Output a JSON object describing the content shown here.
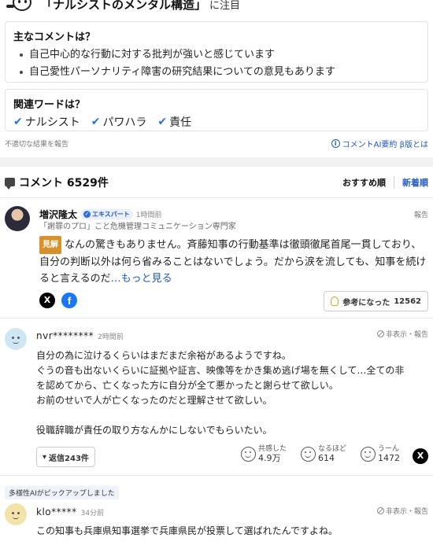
{
  "header": {
    "title": "「ナルシストのメンタル構造」",
    "suffix": "に注目"
  },
  "summary": {
    "title": "主なコメントは？",
    "bullets": [
      "自己中心的な行動に対する批判が強いと感じています",
      "自己愛性パーソナリティ障害の研究結果についての意見もあります"
    ]
  },
  "related": {
    "title": "関連ワードは？",
    "words": [
      "ナルシスト",
      "パワハラ",
      "責任"
    ]
  },
  "report_inappropriate": "不適切な結果を報告",
  "ai_summary_link": "コメントAI要約 β版とは",
  "comments_header": {
    "title": "コメント 6529件",
    "sort_recommended": "おすすめ順",
    "sort_newest": "新着順"
  },
  "expert_comment": {
    "name": "増沢隆太",
    "badge": "エキスパート",
    "time": "1時間前",
    "report": "報告",
    "title": "「謝罪のプロ」こと危機管理コミュニケーション専門家",
    "label": "見解",
    "body": "なんの驚きもありません。斉藤知事の行動基準は徹頭徹尾首尾一貫しており、自分の判断以外は何ら省みることはないでしょう。だから涙を流しても、知事を続けると言えるのだ",
    "more": "…もっと見る",
    "share_x": "X",
    "share_fb": "f",
    "helpful_label": "参考になった",
    "helpful_count": "12562"
  },
  "comment1": {
    "user": "nvr********",
    "time": "2時間前",
    "actions": "非表示・報告",
    "lines": [
      "自分の為に泣けるくらいはまだまだ余裕があるようですね。",
      "ぐうの音も出ないくらいに証拠や証言、映像等をかき集め逃げ場を無くして…全ての非",
      "を認めてから、亡くなった方に自分が全て悪かったと謝らせて欲しい。",
      "お前のせいで人が亡くなったのだと理解させて欲しい。",
      "",
      "役職辞職が責任の取り方なんかにしないでもらいたい。"
    ],
    "replies": "返信243件",
    "reactions": [
      {
        "label": "共感した",
        "count": "4.9万"
      },
      {
        "label": "なるほど",
        "count": "614"
      },
      {
        "label": "うーん",
        "count": "1472"
      }
    ],
    "share_x": "X",
    "avatar_color": "#cfe6f5"
  },
  "pickup_label": "多様性AIがピックアップしました",
  "comment2": {
    "user": "klo*****",
    "time": "34分前",
    "actions": "非表示・報告",
    "lines": [
      "この知事も兵庫県知事選挙で兵庫県民が投票して選ばれたんですよね。"
    ],
    "avatar_color": "#f3e3a8"
  }
}
